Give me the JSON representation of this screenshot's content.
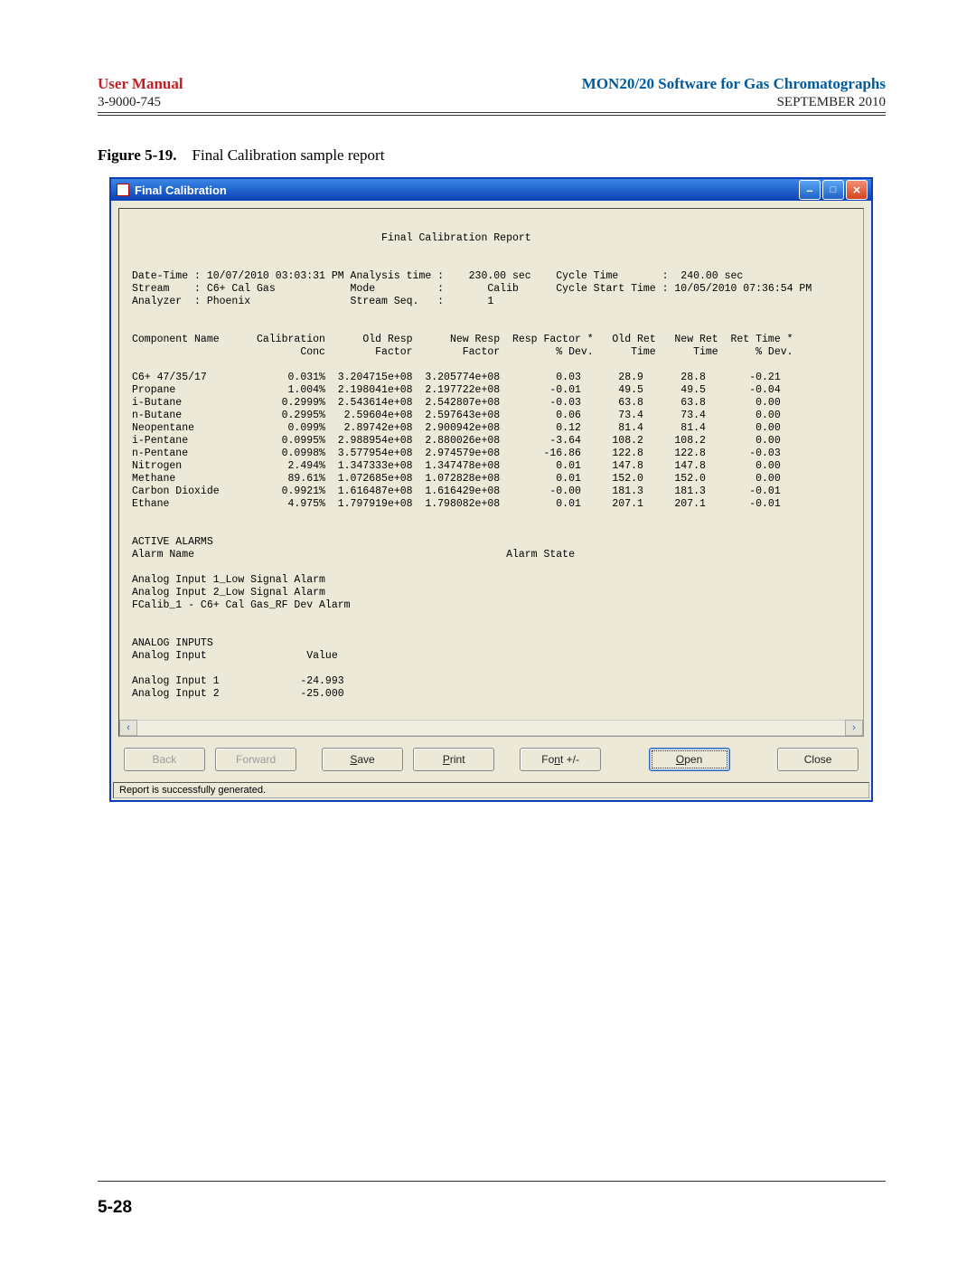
{
  "doc": {
    "manual_title": "User Manual",
    "product_title": "MON20/20 Software for Gas Chromatographs",
    "doc_number": "3-9000-745",
    "date": "SEPTEMBER 2010",
    "figure_label": "Figure 5-19.",
    "figure_caption": "Final Calibration sample report",
    "page_number": "5-28"
  },
  "window": {
    "title": "Final Calibration",
    "status": "Report is successfully generated.",
    "buttons": {
      "back": "Back",
      "forward": "Forward",
      "save": "Save",
      "print": "Print",
      "font": "Font +/-",
      "open": "Open",
      "close": "Close"
    }
  },
  "report": {
    "title": "Final Calibration Report",
    "meta_left": [
      {
        "label": "Date-Time",
        "value": "10/07/2010 03:03:31 PM"
      },
      {
        "label": "Stream",
        "value": "C6+ Cal Gas"
      },
      {
        "label": "Analyzer",
        "value": "Phoenix"
      }
    ],
    "meta_mid": [
      {
        "label": "Analysis time",
        "value": "230.00 sec"
      },
      {
        "label": "Mode",
        "value": "Calib"
      },
      {
        "label": "Stream Seq.",
        "value": "1"
      }
    ],
    "meta_right": [
      {
        "label": "Cycle Time",
        "value": "240.00 sec"
      },
      {
        "label": "Cycle Start Time",
        "value": "10/05/2010 07:36:54 PM"
      }
    ],
    "columns_line1": [
      "Component Name",
      "Calibration",
      "Old Resp",
      "New Resp",
      "Resp Factor *",
      "Old Ret",
      "New Ret",
      "Ret Time *"
    ],
    "columns_line2": [
      "",
      "Conc",
      "Factor",
      "Factor",
      "% Dev.",
      "Time",
      "Time",
      "% Dev."
    ],
    "rows": [
      {
        "name": "C6+ 47/35/17",
        "conc": "0.031%",
        "old_rf": "3.204715e+08",
        "new_rf": "3.205774e+08",
        "rf_dev": "0.03",
        "old_rt": "28.9",
        "new_rt": "28.8",
        "rt_dev": "-0.21"
      },
      {
        "name": "Propane",
        "conc": "1.004%",
        "old_rf": "2.198041e+08",
        "new_rf": "2.197722e+08",
        "rf_dev": "-0.01",
        "old_rt": "49.5",
        "new_rt": "49.5",
        "rt_dev": "-0.04"
      },
      {
        "name": "i-Butane",
        "conc": "0.2999%",
        "old_rf": "2.543614e+08",
        "new_rf": "2.542807e+08",
        "rf_dev": "-0.03",
        "old_rt": "63.8",
        "new_rt": "63.8",
        "rt_dev": "0.00"
      },
      {
        "name": "n-Butane",
        "conc": "0.2995%",
        "old_rf": "2.59604e+08",
        "new_rf": "2.597643e+08",
        "rf_dev": "0.06",
        "old_rt": "73.4",
        "new_rt": "73.4",
        "rt_dev": "0.00"
      },
      {
        "name": "Neopentane",
        "conc": "0.099%",
        "old_rf": "2.89742e+08",
        "new_rf": "2.900942e+08",
        "rf_dev": "0.12",
        "old_rt": "81.4",
        "new_rt": "81.4",
        "rt_dev": "0.00"
      },
      {
        "name": "i-Pentane",
        "conc": "0.0995%",
        "old_rf": "2.988954e+08",
        "new_rf": "2.880026e+08",
        "rf_dev": "-3.64",
        "old_rt": "108.2",
        "new_rt": "108.2",
        "rt_dev": "0.00"
      },
      {
        "name": "n-Pentane",
        "conc": "0.0998%",
        "old_rf": "3.577954e+08",
        "new_rf": "2.974579e+08",
        "rf_dev": "-16.86",
        "old_rt": "122.8",
        "new_rt": "122.8",
        "rt_dev": "-0.03"
      },
      {
        "name": "Nitrogen",
        "conc": "2.494%",
        "old_rf": "1.347333e+08",
        "new_rf": "1.347478e+08",
        "rf_dev": "0.01",
        "old_rt": "147.8",
        "new_rt": "147.8",
        "rt_dev": "0.00"
      },
      {
        "name": "Methane",
        "conc": "89.61%",
        "old_rf": "1.072685e+08",
        "new_rf": "1.072828e+08",
        "rf_dev": "0.01",
        "old_rt": "152.0",
        "new_rt": "152.0",
        "rt_dev": "0.00"
      },
      {
        "name": "Carbon Dioxide",
        "conc": "0.9921%",
        "old_rf": "1.616487e+08",
        "new_rf": "1.616429e+08",
        "rf_dev": "-0.00",
        "old_rt": "181.3",
        "new_rt": "181.3",
        "rt_dev": "-0.01"
      },
      {
        "name": "Ethane",
        "conc": "4.975%",
        "old_rf": "1.797919e+08",
        "new_rf": "1.798082e+08",
        "rf_dev": "0.01",
        "old_rt": "207.1",
        "new_rt": "207.1",
        "rt_dev": "-0.01"
      }
    ],
    "alarms_header": "ACTIVE ALARMS",
    "alarms_cols": [
      "Alarm Name",
      "Alarm State"
    ],
    "alarms": [
      "Analog Input 1_Low Signal Alarm",
      "Analog Input 2_Low Signal Alarm",
      "FCalib_1 - C6+ Cal Gas_RF Dev Alarm"
    ],
    "analog_header": "ANALOG INPUTS",
    "analog_cols": [
      "Analog Input",
      "Value"
    ],
    "analog": [
      {
        "name": "Analog Input 1",
        "value": "-24.993"
      },
      {
        "name": "Analog Input 2",
        "value": "-25.000"
      }
    ]
  }
}
